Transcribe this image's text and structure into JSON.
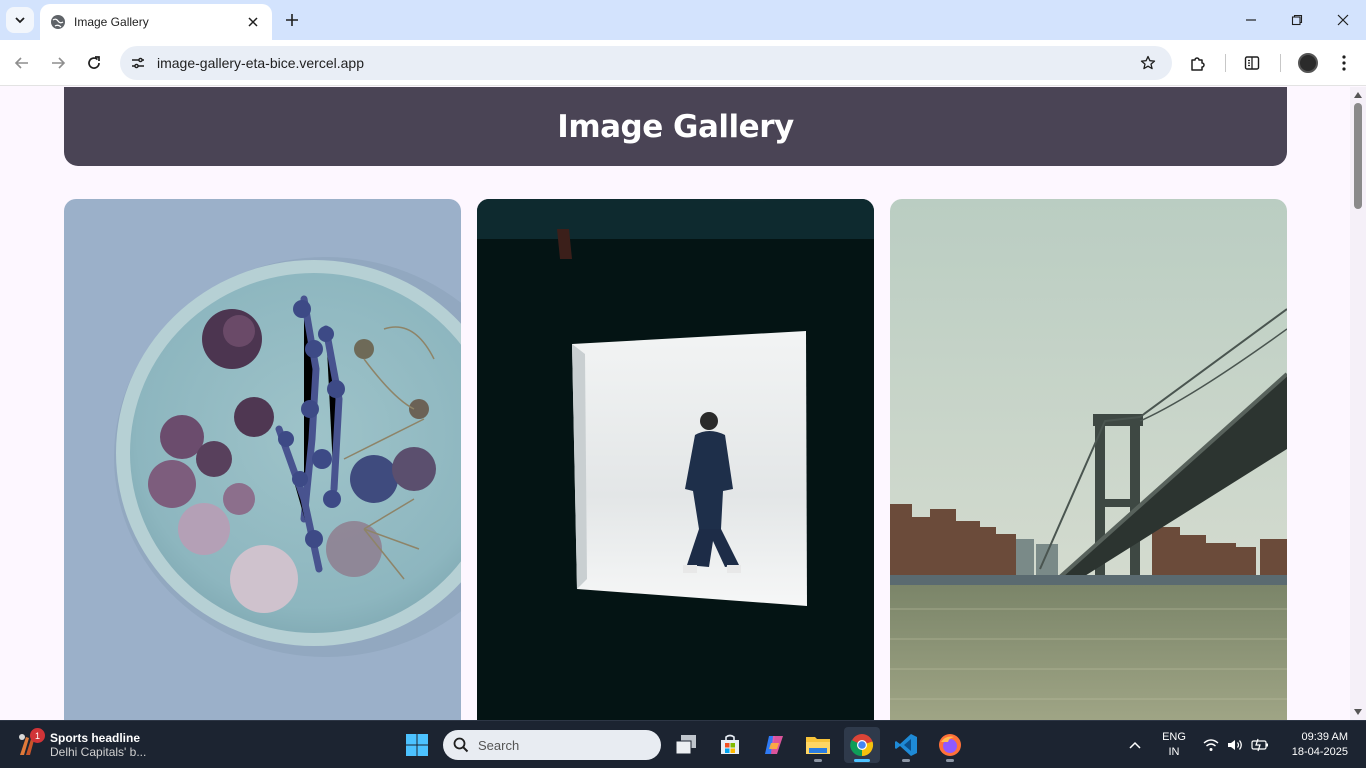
{
  "browser": {
    "tab": {
      "title": "Image Gallery"
    },
    "address_bar": {
      "url": "image-gallery-eta-bice.vercel.app"
    }
  },
  "page": {
    "header": {
      "title": "Image Gallery"
    },
    "gallery": {
      "images": [
        {
          "subject": "dried-flowers-on-plate"
        },
        {
          "subject": "person-in-lightbox-studio"
        },
        {
          "subject": "bridge-over-river-city"
        }
      ]
    }
  },
  "taskbar": {
    "news": {
      "badge": "1",
      "title": "Sports headline",
      "subtitle": "Delhi Capitals' b..."
    },
    "search": {
      "placeholder": "Search"
    },
    "apps": [
      "windows-start",
      "search",
      "task-view",
      "microsoft-store",
      "copilot",
      "file-explorer",
      "google-chrome",
      "vs-code",
      "firefox"
    ],
    "tray": {
      "language": {
        "line1": "ENG",
        "line2": "IN"
      },
      "clock": {
        "time": "09:39 AM",
        "date": "18-04-2025"
      }
    }
  },
  "colors": {
    "header_bg": "#4a4455",
    "page_bg": "#fdf7ff",
    "tab_strip": "#d3e3fd",
    "taskbar_bg": "#1c2431"
  }
}
